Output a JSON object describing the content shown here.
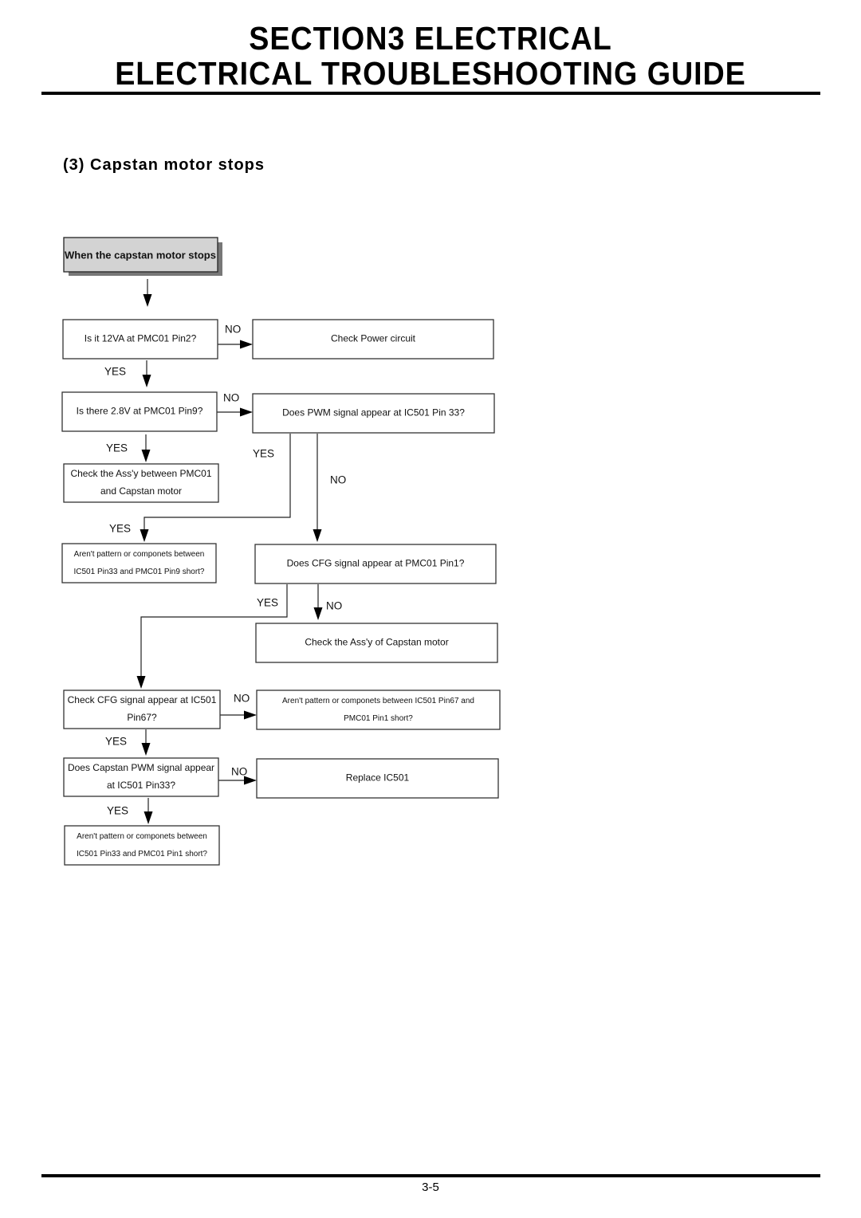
{
  "header": {
    "title_line1": "SECTION3   ELECTRICAL",
    "title_line2": "ELECTRICAL TROUBLESHOOTING GUIDE"
  },
  "section": {
    "subtitle": "(3) Capstan motor stops"
  },
  "flowchart": {
    "start": "When the capstan motor stops",
    "nodes": {
      "q_12va": [
        "Is it 12VA at PMC01 Pin2?"
      ],
      "check_power": [
        "Check Power circuit"
      ],
      "q_28v": [
        "Is there 2.8V at PMC01 Pin9?"
      ],
      "q_pwm_ic501": [
        "Does PWM signal appear at IC501 Pin 33?"
      ],
      "check_assy_pmc01": [
        "Check the Ass'y between PMC01",
        "and Capstan motor"
      ],
      "short_pin33_pin9": [
        "Aren't pattern or componets between",
        "IC501 Pin33 and PMC01 Pin9 short?"
      ],
      "q_cfg_pmc01": [
        "Does CFG signal appear at PMC01 Pin1?"
      ],
      "check_assy_motor": [
        "Check the Ass'y of Capstan motor"
      ],
      "q_cfg_ic501": [
        "Check CFG signal appear at IC501",
        "Pin67?"
      ],
      "short_pin67_pin1": [
        "Aren't pattern or componets between IC501 Pin67 and",
        "PMC01 Pin1 short?"
      ],
      "q_capstan_pwm": [
        "Does Capstan PWM signal appear",
        "at IC501 Pin33?"
      ],
      "replace_ic501": [
        "Replace IC501"
      ],
      "short_pin33_pin1": [
        "Aren't pattern or componets between",
        "IC501 Pin33 and PMC01 Pin1 short?"
      ]
    },
    "labels": {
      "yes": "YES",
      "no": "NO"
    }
  },
  "footer": {
    "page_number": "3-5"
  }
}
